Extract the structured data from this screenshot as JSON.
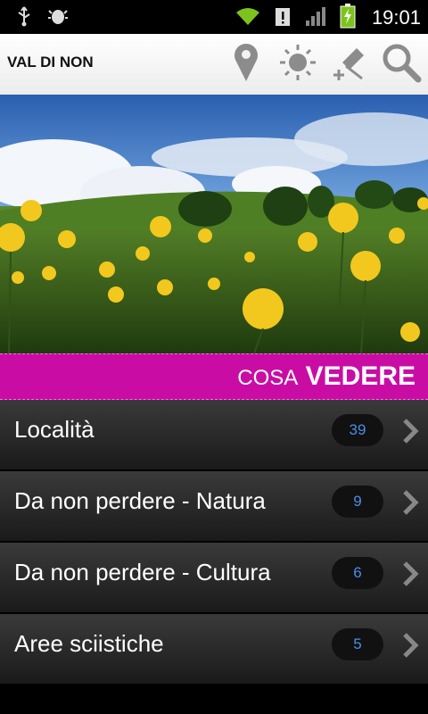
{
  "statusbar": {
    "left_icons": [
      "usb-icon",
      "android-debug-icon"
    ],
    "right_icons": [
      "wifi-icon",
      "alert-icon",
      "signal-icon",
      "battery-charging-icon"
    ],
    "time": "19:01"
  },
  "appbar": {
    "title": "VAL DI NON",
    "actions": [
      "map-pin-icon",
      "sun-icon",
      "add-pin-icon",
      "search-icon"
    ]
  },
  "section": {
    "title_light": "COSA",
    "title_bold": "VEDERE",
    "color": "#c90da4"
  },
  "items": [
    {
      "label": "Località",
      "count": "39"
    },
    {
      "label": "Da non perdere - Natura",
      "count": "9"
    },
    {
      "label": "Da non perdere - Cultura",
      "count": "6"
    },
    {
      "label": "Aree sciistiche",
      "count": "5"
    }
  ]
}
